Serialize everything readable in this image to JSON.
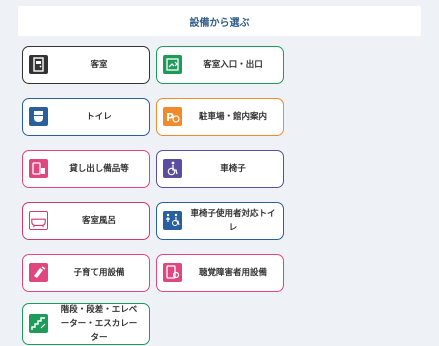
{
  "header": {
    "title": "設備から選ぶ"
  },
  "categories": [
    {
      "label": "客室",
      "icon": "room-door-icon",
      "color": "#333333"
    },
    {
      "label": "客室入口・出口",
      "icon": "room-entrance-icon",
      "color": "#1e9a5a"
    },
    {
      "label": "トイレ",
      "icon": "toilet-icon",
      "color": "#2a5f9e"
    },
    {
      "label": "駐車場・館内案内",
      "icon": "parking-icon",
      "color": "#f08a2b"
    },
    {
      "label": "貸し出し備品等",
      "icon": "rental-items-icon",
      "color": "#e0467f"
    },
    {
      "label": "車椅子",
      "icon": "wheelchair-icon",
      "color": "#5b4ea0"
    },
    {
      "label": "客室風呂",
      "icon": "bathtub-icon",
      "color": "#d23a6f"
    },
    {
      "label": "車椅子使用者対応トイレ",
      "icon": "accessible-toilet-icon",
      "color": "#2a5f9e"
    },
    {
      "label": "子育て用設備",
      "icon": "baby-bottle-icon",
      "color": "#e0467f"
    },
    {
      "label": "聴覚障害者用設備",
      "icon": "hearing-device-icon",
      "color": "#e0467f"
    },
    {
      "label": "階段・段差・エレベーター・エスカレーター",
      "icon": "stairs-elevator-icon",
      "color": "#1e9a5a"
    }
  ]
}
